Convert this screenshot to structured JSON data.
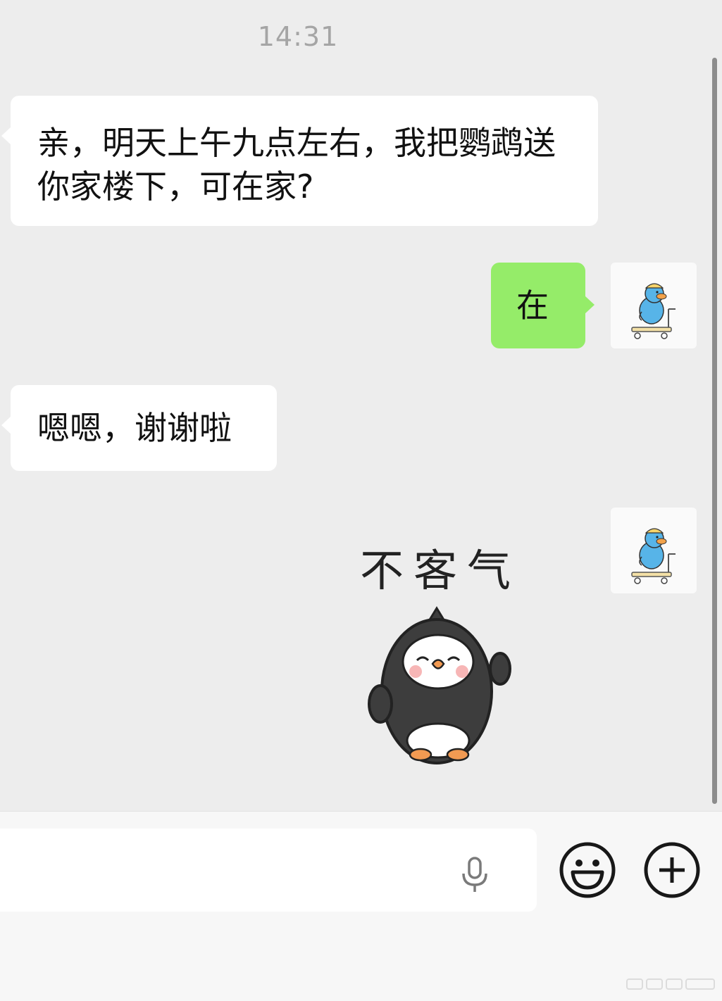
{
  "chat": {
    "timestamp": "14:31",
    "messages": [
      {
        "sender": "other",
        "text": "亲，明天上午九点左右，我把鹦鹉送你家楼下，可在家?"
      },
      {
        "sender": "me",
        "text": "在"
      },
      {
        "sender": "other",
        "text": "嗯嗯，谢谢啦"
      },
      {
        "sender": "me",
        "type": "sticker",
        "text": "不客气"
      }
    ]
  },
  "avatar": {
    "icon": "blue-bird-on-cart"
  },
  "input_bar": {
    "input_value": "",
    "voice_icon": "microphone-icon",
    "emoji_icon": "smiley-face-icon",
    "more_icon": "plus-circle-icon"
  },
  "colors": {
    "background": "#ededed",
    "incoming_bubble": "#ffffff",
    "outgoing_bubble": "#95ec69",
    "timestamp": "#a5a5a5"
  }
}
